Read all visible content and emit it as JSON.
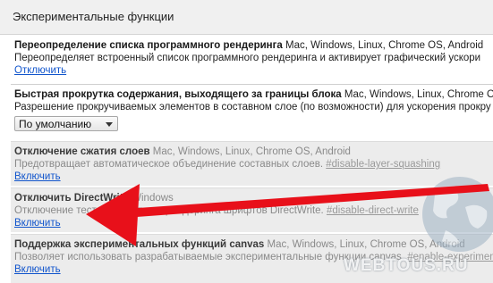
{
  "header": {
    "title": "Экспериментальные функции"
  },
  "experiments": [
    {
      "name": "Переопределение списка программного рендеринга",
      "platforms": " Mac, Windows, Linux, Chrome OS, Android",
      "description": "Переопределяет встроенный список программного рендеринга и активирует графический ускори",
      "link": "Отключить",
      "state": "enabled"
    },
    {
      "name": "Быстрая прокрутка содержания, выходящего за границы блока",
      "platforms": " Mac, Windows, Linux, Chrome OS, Android",
      "description": "Разрешение прокручиваемых элементов в составном слое (по возможности) для ускорения прокру",
      "select_value": "По умолчанию",
      "state": "enabled"
    },
    {
      "name": "Отключение сжатия слоев",
      "platforms": " Mac, Windows, Linux, Chrome OS, Android",
      "description": "Предотвращает автоматическое объединение составных слоев. ",
      "hash": "#disable-layer-squashing",
      "link": "Включить",
      "state": "disabled"
    },
    {
      "name": "Отключить DirectWrite",
      "platforms": " Windows",
      "description": "Отключение тестовой системы рендеринга шрифтов DirectWrite. ",
      "hash": "#disable-direct-write",
      "link": "Включить",
      "state": "disabled"
    },
    {
      "name": "Поддержка экспериментальных функций canvas",
      "platforms": " Mac, Windows, Linux, Chrome OS, Android",
      "description": "Позволяет использовать разрабатываемые экспериментальные функции canvas. ",
      "hash": "#enable-experimen",
      "link": "Включить",
      "state": "disabled"
    }
  ],
  "watermark": {
    "text": "WEBTOUS.RU"
  },
  "colors": {
    "link": "#1155cc",
    "arrow": "#e8101a",
    "header_bg": "#f0f0f0",
    "disabled_bg": "#ececec"
  }
}
